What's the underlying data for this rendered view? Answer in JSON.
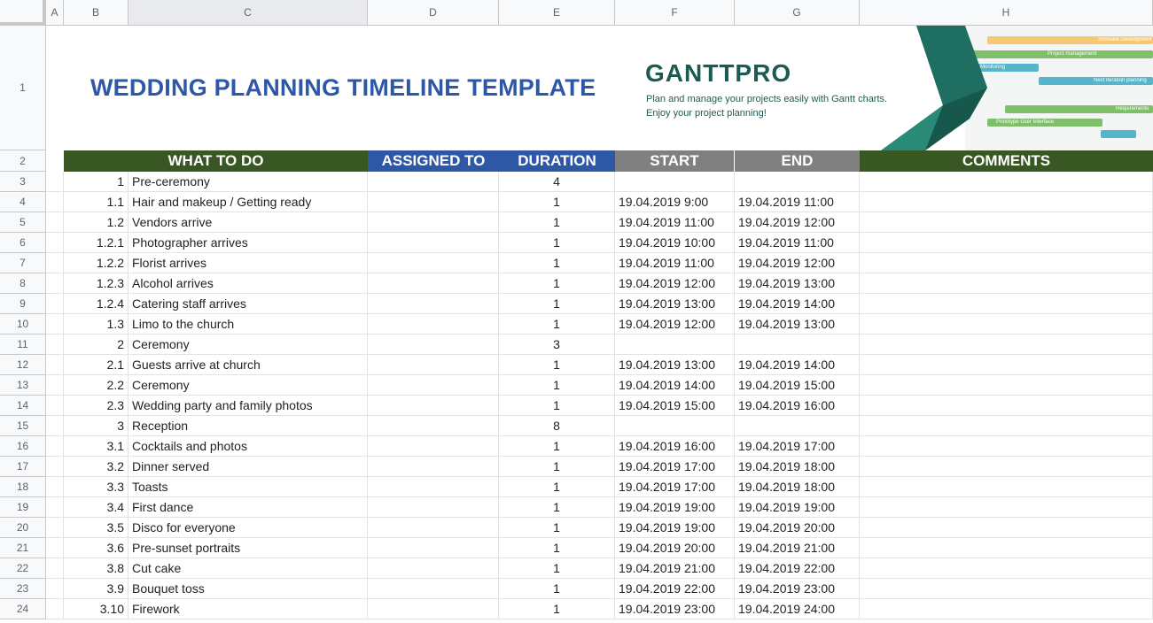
{
  "columns": [
    "A",
    "B",
    "C",
    "D",
    "E",
    "F",
    "G",
    "H"
  ],
  "title": "WEDDING PLANNING TIMELINE TEMPLATE",
  "banner": {
    "logo": "GANTTPRO",
    "line1": "Plan and manage your projects easily with Gantt charts.",
    "line2": "Enjoy your project planning!",
    "bars": [
      "Software Development",
      "Project management",
      "Monitoring",
      "Next iteration planning",
      "Requirements",
      "Prototype User Interface"
    ]
  },
  "headers": {
    "what": "WHAT TO DO",
    "assigned": "ASSIGNED TO",
    "duration": "DURATION",
    "start": "START",
    "end": "END",
    "comments": "COMMENTS"
  },
  "colors": {
    "green_header": "#385723",
    "blue_header": "#2e57a6",
    "gray_header": "#808080",
    "title": "#2e57a6",
    "logo": "#1c5b52"
  },
  "row_numbers": [
    "1",
    "2",
    "3",
    "4",
    "5",
    "6",
    "7",
    "8",
    "9",
    "10",
    "11",
    "12",
    "13",
    "14",
    "15",
    "16",
    "17",
    "18",
    "19",
    "20",
    "21",
    "22",
    "23",
    "24"
  ],
  "rows": [
    {
      "num": "1",
      "task": "Pre-ceremony",
      "dur": "4",
      "start": "",
      "end": ""
    },
    {
      "num": "1.1",
      "task": "Hair and makeup / Getting ready",
      "dur": "1",
      "start": "19.04.2019 9:00",
      "end": "19.04.2019 11:00"
    },
    {
      "num": "1.2",
      "task": "Vendors arrive",
      "dur": "1",
      "start": "19.04.2019 11:00",
      "end": "19.04.2019 12:00"
    },
    {
      "num": "1.2.1",
      "task": "Photographer arrives",
      "dur": "1",
      "start": "19.04.2019 10:00",
      "end": "19.04.2019 11:00"
    },
    {
      "num": "1.2.2",
      "task": "Florist arrives",
      "dur": "1",
      "start": "19.04.2019 11:00",
      "end": "19.04.2019 12:00"
    },
    {
      "num": "1.2.3",
      "task": "Alcohol arrives",
      "dur": "1",
      "start": "19.04.2019 12:00",
      "end": "19.04.2019 13:00"
    },
    {
      "num": "1.2.4",
      "task": "Catering staff arrives",
      "dur": "1",
      "start": "19.04.2019 13:00",
      "end": "19.04.2019 14:00"
    },
    {
      "num": "1.3",
      "task": "Limo to the church",
      "dur": "1",
      "start": "19.04.2019 12:00",
      "end": "19.04.2019 13:00"
    },
    {
      "num": "2",
      "task": "Ceremony",
      "dur": "3",
      "start": "",
      "end": ""
    },
    {
      "num": "2.1",
      "task": "Guests arrive at church",
      "dur": "1",
      "start": "19.04.2019 13:00",
      "end": "19.04.2019 14:00"
    },
    {
      "num": "2.2",
      "task": "Ceremony",
      "dur": "1",
      "start": "19.04.2019 14:00",
      "end": "19.04.2019 15:00"
    },
    {
      "num": "2.3",
      "task": "Wedding party and family photos",
      "dur": "1",
      "start": "19.04.2019 15:00",
      "end": "19.04.2019 16:00"
    },
    {
      "num": "3",
      "task": "Reception",
      "dur": "8",
      "start": "",
      "end": ""
    },
    {
      "num": "3.1",
      "task": "Cocktails and photos",
      "dur": "1",
      "start": "19.04.2019 16:00",
      "end": "19.04.2019 17:00"
    },
    {
      "num": "3.2",
      "task": "Dinner served",
      "dur": "1",
      "start": "19.04.2019 17:00",
      "end": "19.04.2019 18:00"
    },
    {
      "num": "3.3",
      "task": "Toasts",
      "dur": "1",
      "start": "19.04.2019 17:00",
      "end": "19.04.2019 18:00"
    },
    {
      "num": "3.4",
      "task": "First dance",
      "dur": "1",
      "start": "19.04.2019 19:00",
      "end": "19.04.2019 19:00"
    },
    {
      "num": "3.5",
      "task": "Disco for everyone",
      "dur": "1",
      "start": "19.04.2019 19:00",
      "end": "19.04.2019 20:00"
    },
    {
      "num": "3.6",
      "task": "Pre-sunset portraits",
      "dur": "1",
      "start": "19.04.2019 20:00",
      "end": "19.04.2019 21:00"
    },
    {
      "num": "3.8",
      "task": "Cut cake",
      "dur": "1",
      "start": "19.04.2019 21:00",
      "end": "19.04.2019 22:00"
    },
    {
      "num": "3.9",
      "task": "Bouquet toss",
      "dur": "1",
      "start": "19.04.2019 22:00",
      "end": "19.04.2019 23:00"
    },
    {
      "num": "3.10",
      "task": "Firework",
      "dur": "1",
      "start": "19.04.2019 23:00",
      "end": "19.04.2019 24:00"
    }
  ]
}
